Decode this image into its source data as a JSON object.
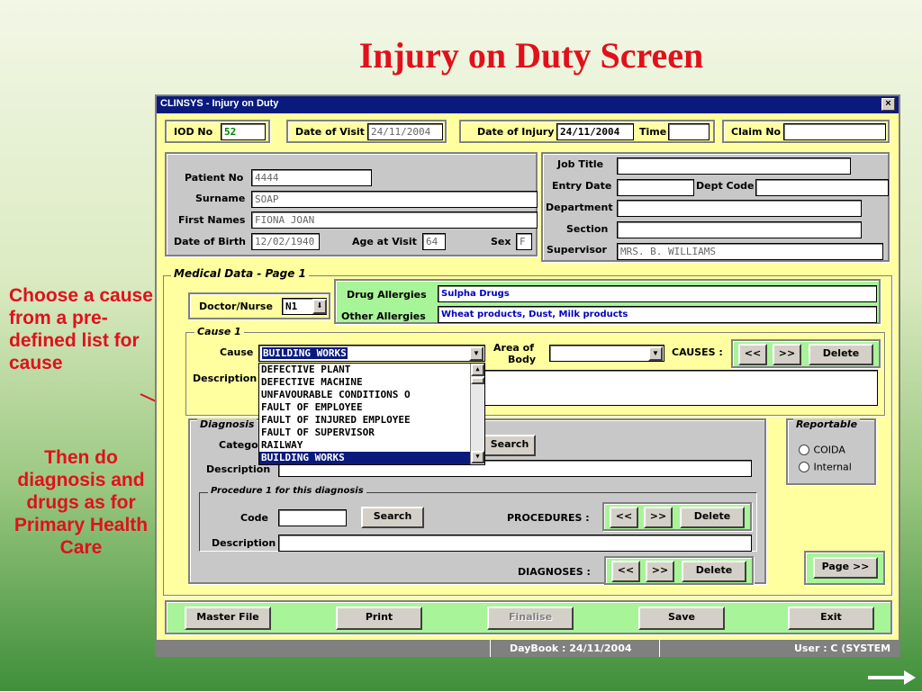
{
  "slide": {
    "title": "Injury on Duty Screen",
    "note1": "Choose a cause from a pre-defined list for cause",
    "note2": "Then do diagnosis and drugs as for Primary Health Care"
  },
  "window": {
    "title": "CLINSYS - Injury on Duty",
    "close": "×"
  },
  "header": {
    "iod_label": "IOD No",
    "iod_value": "52",
    "visit_label": "Date of Visit",
    "visit_value": "24/11/2004",
    "injury_label": "Date of Injury",
    "injury_value": "24/11/2004",
    "time_label": "Time",
    "time_value": "",
    "claim_label": "Claim No",
    "claim_value": ""
  },
  "patient": {
    "patient_no_label": "Patient No",
    "patient_no": "4444",
    "surname_label": "Surname",
    "surname": "SOAP",
    "first_names_label": "First Names",
    "first_names": "FIONA JOAN",
    "dob_label": "Date of Birth",
    "dob": "12/02/1940",
    "age_label": "Age at Visit",
    "age": "64",
    "sex_label": "Sex",
    "sex": "F"
  },
  "job": {
    "job_title_label": "Job Title",
    "job_title": "",
    "entry_date_label": "Entry Date",
    "entry_date": "",
    "dept_code_label": "Dept Code",
    "dept_code": "",
    "department_label": "Department",
    "department": "",
    "section_label": "Section",
    "section": "",
    "supervisor_label": "Supervisor",
    "supervisor": "MRS. B. WILLIAMS"
  },
  "medical": {
    "legend": "Medical Data - Page 1",
    "doctor_label": "Doctor/Nurse",
    "doctor_value": "N1",
    "drug_allergies_label": "Drug Allergies",
    "drug_allergies": "Sulpha Drugs",
    "other_allergies_label": "Other Allergies",
    "other_allergies": "Wheat products, Dust, Milk products"
  },
  "cause": {
    "legend": "Cause 1",
    "cause_label": "Cause",
    "cause_value": "BUILDING WORKS",
    "area_label_1": "Area of",
    "area_label_2": "Body",
    "area_value": "",
    "causes_label": "CAUSES :",
    "prev": "<<",
    "next": ">>",
    "delete": "Delete",
    "description_label": "Description",
    "options": [
      "DEFECTIVE PLANT",
      "DEFECTIVE MACHINE",
      "UNFAVOURABLE CONDITIONS O",
      "FAULT OF EMPLOYEE",
      "FAULT OF INJURED EMPLOYEE",
      "FAULT OF SUPERVISOR",
      "RAILWAY",
      "BUILDING WORKS"
    ]
  },
  "diagnosis": {
    "legend": "Diagnosis",
    "category_label": "Catego",
    "search": "Search",
    "description_label": "Description",
    "procedure_legend": "Procedure 1 for this diagnosis",
    "code_label": "Code",
    "code_search": "Search",
    "procedures_label": "PROCEDURES :",
    "proc_prev": "<<",
    "proc_next": ">>",
    "proc_delete": "Delete",
    "proc_description_label": "Description",
    "diagnoses_label": "DIAGNOSES :",
    "diag_prev": "<<",
    "diag_next": ">>",
    "diag_delete": "Delete"
  },
  "reportable": {
    "legend": "Reportable",
    "opt1": "COIDA",
    "opt2": "Internal"
  },
  "page_button": "Page >>",
  "footer": {
    "master_file": "Master File",
    "print": "Print",
    "finalise": "Finalise",
    "save": "Save",
    "exit": "Exit"
  },
  "status": {
    "daybook": "DayBook : 24/11/2004",
    "user": "User : C  (SYSTEM"
  }
}
